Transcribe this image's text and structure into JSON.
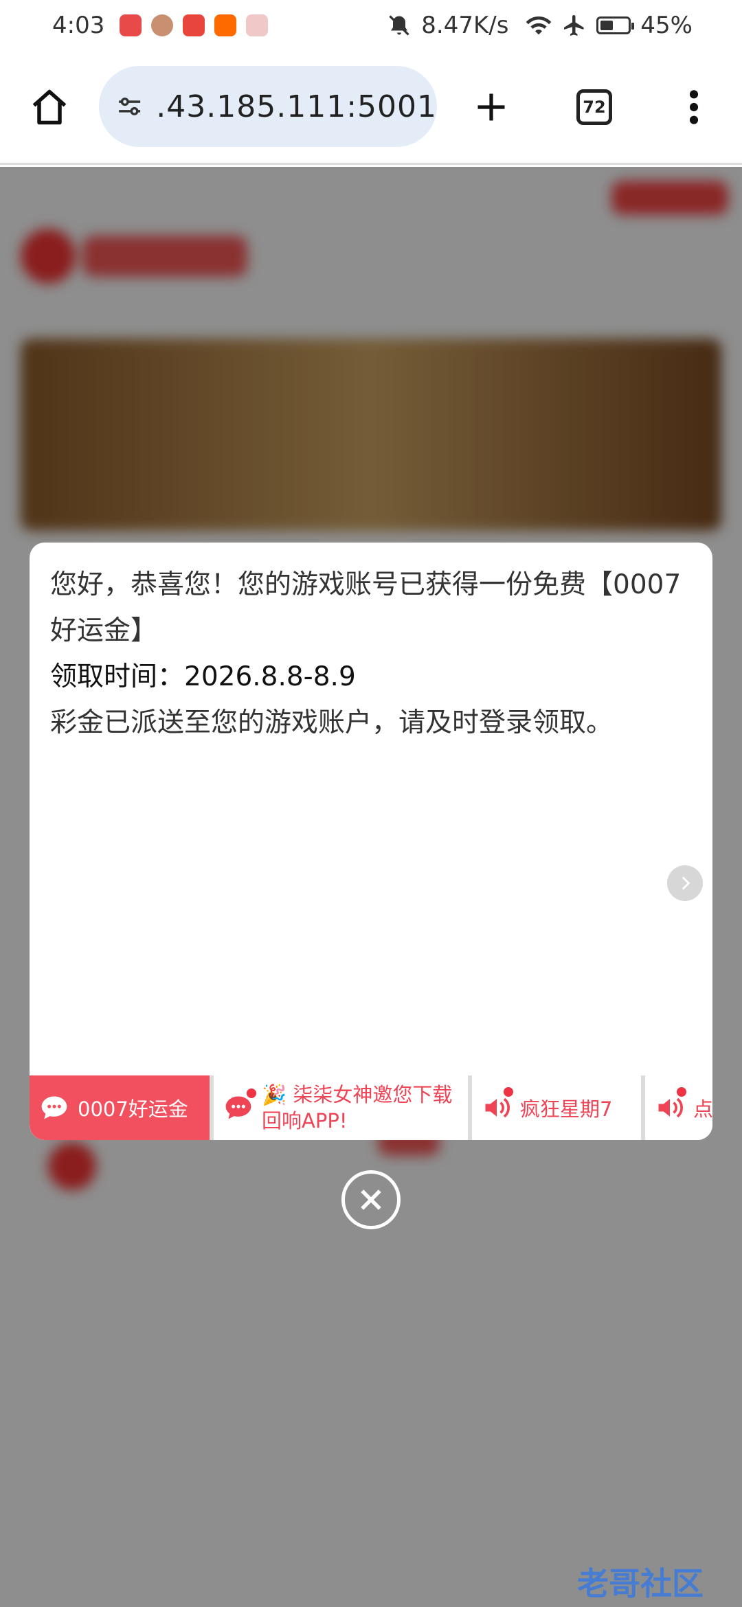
{
  "status_bar": {
    "time": "4:03",
    "network_speed": "8.47K/s",
    "battery_percent": "45%",
    "battery_level": 0.45,
    "icons": [
      "huawei-app-icon",
      "avatar-app-icon",
      "game-app-icon",
      "taobao-icon",
      "box-app-icon",
      "mute-icon",
      "wifi-icon",
      "airplane-icon",
      "battery-icon"
    ]
  },
  "browser": {
    "url": ".43.185.111:5001",
    "tab_count": "72",
    "icons": [
      "home-icon",
      "site-settings-icon",
      "new-tab-icon",
      "tabs-icon",
      "more-icon"
    ]
  },
  "popup": {
    "message_line1": "您好，恭喜您！您的游戏账号已获得一份免费【0007好运金】",
    "message_line2": "领取时间：2026.8.8-8.9",
    "message_line3": "彩金已派送至您的游戏账户，请及时登录领取。",
    "tabs": [
      {
        "label": "0007好运金",
        "icon": "chat-icon",
        "active": true
      },
      {
        "label": "🎉 柒柒女神邀您下载回响APP!",
        "icon": "chat-icon",
        "active": false
      },
      {
        "label": "疯狂星期7",
        "icon": "speaker-icon",
        "active": false
      },
      {
        "label": "点",
        "icon": "speaker-icon",
        "active": false
      }
    ]
  },
  "colors": {
    "accent_red": "#f2505e",
    "url_bar_bg": "#e4ecf7"
  },
  "watermark": "老哥社区"
}
